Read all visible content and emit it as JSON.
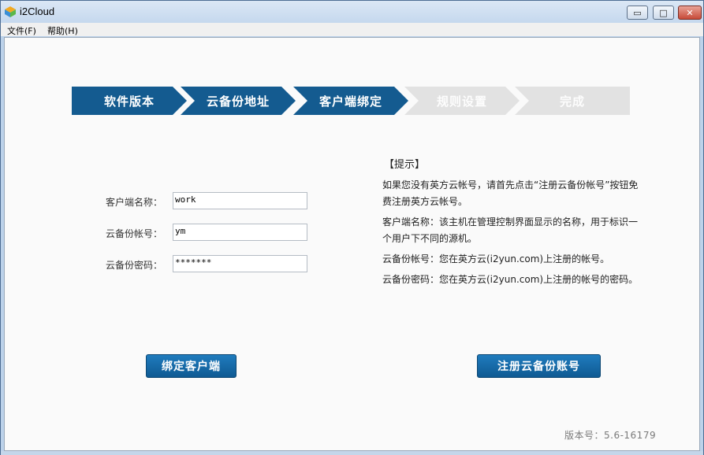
{
  "window": {
    "title": "i2Cloud",
    "minimize_glyph": "▭",
    "maximize_glyph": "□",
    "close_glyph": "✕"
  },
  "menu": [
    {
      "label": "文件(F)"
    },
    {
      "label": "帮助(H)"
    }
  ],
  "wizard": {
    "steps": [
      {
        "label": "软件版本",
        "state": "done"
      },
      {
        "label": "云备份地址",
        "state": "done"
      },
      {
        "label": "客户端绑定",
        "state": "current"
      },
      {
        "label": "规则设置",
        "state": "pending"
      },
      {
        "label": "完成",
        "state": "pending"
      }
    ]
  },
  "form": {
    "client_name": {
      "label": "客户端名称：",
      "value": "work"
    },
    "account": {
      "label": "云备份帐号：",
      "value": "ym"
    },
    "password": {
      "label": "云备份密码：",
      "value": "*******"
    }
  },
  "hint": {
    "title": "【提示】",
    "paragraphs": [
      "如果您没有英方云帐号，请首先点击“注册云备份帐号”按钮免费注册英方云帐号。",
      "客户端名称：该主机在管理控制界面显示的名称，用于标识一个用户下不同的源机。",
      "云备份帐号：您在英方云(i2yun.com)上注册的帐号。",
      "云备份密码：您在英方云(i2yun.com)上注册的帐号的密码。"
    ]
  },
  "buttons": {
    "bind": "绑定客户端",
    "register": "注册云备份账号"
  },
  "version": "版本号：5.6-16179",
  "colors": {
    "step_active": "#145b90",
    "step_inactive": "#e2e2e2",
    "button": "#1470b0"
  }
}
